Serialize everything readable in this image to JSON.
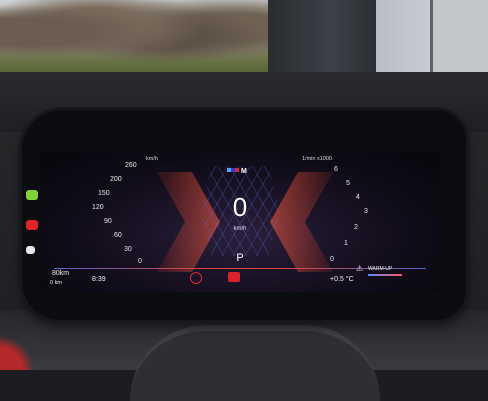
{
  "speedometer": {
    "unit": "km/h",
    "ticks": [
      "260",
      "200",
      "150",
      "120",
      "90",
      "60",
      "30",
      "0"
    ],
    "current_speed": "0",
    "current_unit": "km/h"
  },
  "tachometer": {
    "unit": "1/min x1000",
    "ticks": [
      "6",
      "5",
      "4",
      "3",
      "2",
      "1",
      "0"
    ]
  },
  "gear": "P",
  "status": {
    "range": "80km",
    "range_icon": "fuel-pump-icon",
    "odometer": "0 km",
    "time": "8:39",
    "temperature": "+0.5 °C",
    "warning_text": "WARM-UP",
    "warning_icon": "warning-triangle-icon"
  },
  "indicators": {
    "top_lamp_color": "#7fd43a",
    "bottom_lamp_color": "#e0252a",
    "center_icon_color": "#d8242a"
  },
  "brand_badge": "M"
}
